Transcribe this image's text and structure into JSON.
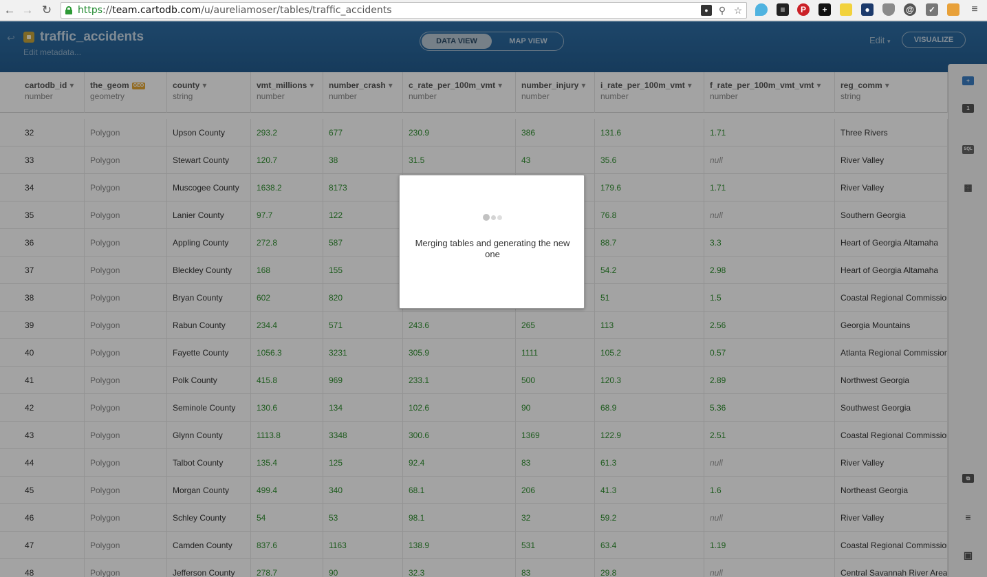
{
  "browser": {
    "url_scheme": "https",
    "url_sep": "://",
    "url_host": "team.cartodb.com",
    "url_path": "/u/aureliamoser/tables/traffic_accidents"
  },
  "header": {
    "title": "traffic_accidents",
    "subtitle": "Edit metadata...",
    "tabs": [
      {
        "label": "DATA VIEW",
        "active": true
      },
      {
        "label": "MAP VIEW",
        "active": false
      }
    ],
    "edit_label": "Edit",
    "visualize_label": "VISUALIZE",
    "accent": "#2f6fa6"
  },
  "table": {
    "geo_badge": "GEO",
    "columns": [
      {
        "name": "cartodb_id",
        "type": "number"
      },
      {
        "name": "the_geom",
        "type": "geometry"
      },
      {
        "name": "county",
        "type": "string"
      },
      {
        "name": "vmt_millions",
        "type": "number"
      },
      {
        "name": "number_crash",
        "type": "number"
      },
      {
        "name": "c_rate_per_100m_vmt",
        "type": "number"
      },
      {
        "name": "number_injury",
        "type": "number"
      },
      {
        "name": "i_rate_per_100m_vmt",
        "type": "number"
      },
      {
        "name": "f_rate_per_100m_vmt_vmt",
        "type": "number"
      },
      {
        "name": "reg_comm",
        "type": "string"
      }
    ],
    "rows": [
      [
        "32",
        "Polygon",
        "Upson County",
        "293.2",
        "677",
        "230.9",
        "386",
        "131.6",
        "1.71",
        "Three Rivers"
      ],
      [
        "33",
        "Polygon",
        "Stewart County",
        "120.7",
        "38",
        "31.5",
        "43",
        "35.6",
        "null",
        "River Valley"
      ],
      [
        "34",
        "Polygon",
        "Muscogee County",
        "1638.2",
        "8173",
        "",
        "",
        "179.6",
        "1.71",
        "River Valley"
      ],
      [
        "35",
        "Polygon",
        "Lanier County",
        "97.7",
        "122",
        "",
        "",
        "76.8",
        "null",
        "Southern Georgia"
      ],
      [
        "36",
        "Polygon",
        "Appling County",
        "272.8",
        "587",
        "",
        "",
        "88.7",
        "3.3",
        "Heart of Georgia Altamaha"
      ],
      [
        "37",
        "Polygon",
        "Bleckley County",
        "168",
        "155",
        "",
        "",
        "54.2",
        "2.98",
        "Heart of Georgia Altamaha"
      ],
      [
        "38",
        "Polygon",
        "Bryan County",
        "602",
        "820",
        "",
        "",
        "51",
        "1.5",
        "Coastal Regional Commission"
      ],
      [
        "39",
        "Polygon",
        "Rabun County",
        "234.4",
        "571",
        "243.6",
        "265",
        "113",
        "2.56",
        "Georgia Mountains"
      ],
      [
        "40",
        "Polygon",
        "Fayette County",
        "1056.3",
        "3231",
        "305.9",
        "1111",
        "105.2",
        "0.57",
        "Atlanta Regional Commission"
      ],
      [
        "41",
        "Polygon",
        "Polk County",
        "415.8",
        "969",
        "233.1",
        "500",
        "120.3",
        "2.89",
        "Northwest Georgia"
      ],
      [
        "42",
        "Polygon",
        "Seminole County",
        "130.6",
        "134",
        "102.6",
        "90",
        "68.9",
        "5.36",
        "Southwest Georgia"
      ],
      [
        "43",
        "Polygon",
        "Glynn County",
        "1113.8",
        "3348",
        "300.6",
        "1369",
        "122.9",
        "2.51",
        "Coastal Regional Commission"
      ],
      [
        "44",
        "Polygon",
        "Talbot County",
        "135.4",
        "125",
        "92.4",
        "83",
        "61.3",
        "null",
        "River Valley"
      ],
      [
        "45",
        "Polygon",
        "Morgan County",
        "499.4",
        "340",
        "68.1",
        "206",
        "41.3",
        "1.6",
        "Northeast Georgia"
      ],
      [
        "46",
        "Polygon",
        "Schley County",
        "54",
        "53",
        "98.1",
        "32",
        "59.2",
        "null",
        "River Valley"
      ],
      [
        "47",
        "Polygon",
        "Camden County",
        "837.6",
        "1163",
        "138.9",
        "531",
        "63.4",
        "1.19",
        "Coastal Regional Commission"
      ],
      [
        "48",
        "Polygon",
        "Jefferson County",
        "278.7",
        "90",
        "32.3",
        "83",
        "29.8",
        "null",
        "Central Savannah River Area"
      ]
    ]
  },
  "right_panel": {
    "icons": [
      "add-layer-icon",
      "filter-icon",
      "sql-icon",
      "chart-icon",
      "merge-icon",
      "table-icon",
      "legend-icon"
    ],
    "sql_label": "SQL"
  },
  "modal": {
    "message": "Merging tables and generating the new one"
  }
}
